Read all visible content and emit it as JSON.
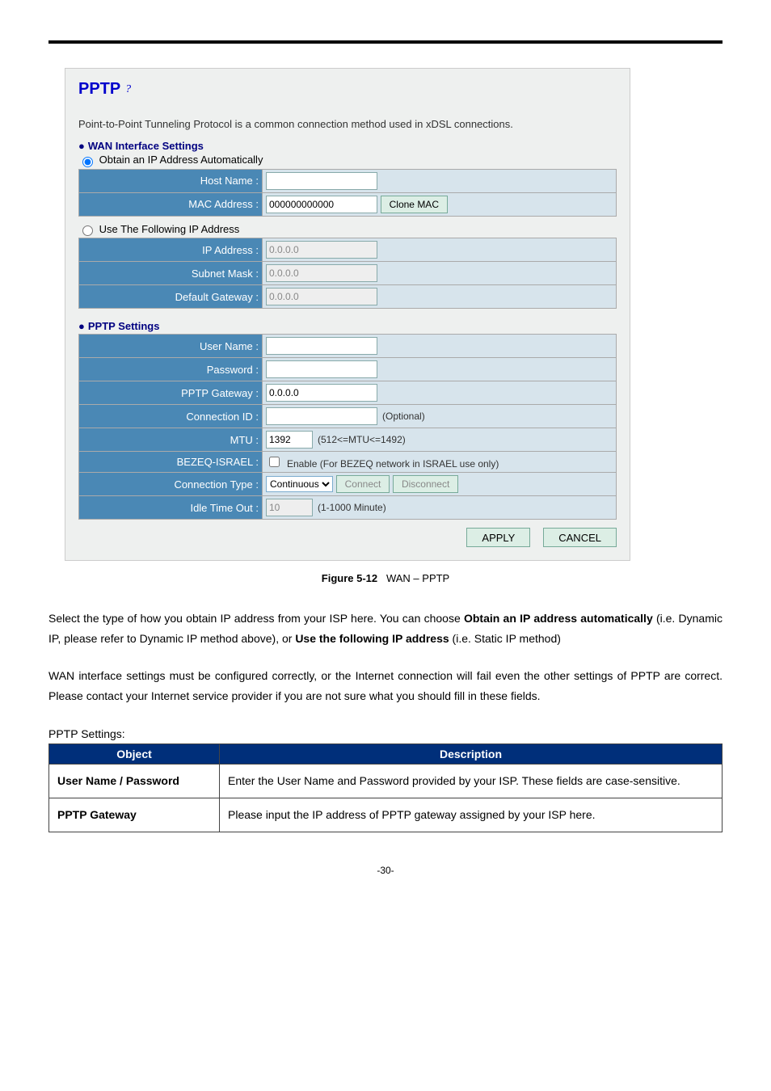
{
  "panel": {
    "title": "PPTP",
    "help_icon": "help-icon",
    "intro": "Point-to-Point Tunneling Protocol is a common connection method used in xDSL connections.",
    "wan_heading": "WAN Interface Settings",
    "obtain_label": "Obtain an IP Address Automatically",
    "use_following_label": "Use The Following IP Address",
    "labels": {
      "host_name": "Host Name :",
      "mac_address": "MAC Address :",
      "ip_address": "IP Address :",
      "subnet_mask": "Subnet Mask :",
      "default_gateway": "Default Gateway :"
    },
    "values": {
      "mac_address": "000000000000",
      "ip_address": "0.0.0.0",
      "subnet_mask": "0.0.0.0",
      "default_gateway": "0.0.0.0"
    },
    "clone_mac": "Clone MAC",
    "pptp_heading": "PPTP Settings",
    "plabels": {
      "user_name": "User Name :",
      "password": "Password :",
      "pptp_gateway": "PPTP Gateway :",
      "connection_id": "Connection ID :",
      "mtu": "MTU :",
      "bezeq": "BEZEQ-ISRAEL :",
      "conn_type": "Connection Type :",
      "idle": "Idle Time Out :"
    },
    "pvalues": {
      "pptp_gateway": "0.0.0.0",
      "conn_id_hint": "(Optional)",
      "mtu": "1392",
      "mtu_hint": "(512<=MTU<=1492)",
      "bezeq_label": "Enable (For BEZEQ network in ISRAEL use only)",
      "conn_type": "Continuous",
      "connect": "Connect",
      "disconnect": "Disconnect",
      "idle": "10",
      "idle_hint": "(1-1000 Minute)"
    },
    "apply": "APPLY",
    "cancel": "CANCEL"
  },
  "figure": {
    "label": "Figure 5-12",
    "caption": "WAN – PPTP"
  },
  "para1_a": "Select the type of how you obtain IP address from your ISP here. You can choose ",
  "para1_b": "Obtain an IP address automatically",
  "para1_c": " (i.e. Dynamic IP, please refer to Dynamic IP method above), or ",
  "para1_d": "Use the following IP address",
  "para1_e": " (i.e. Static IP method)",
  "para2": "WAN interface settings must be configured correctly, or the Internet connection will fail even the other settings of PPTP are correct. Please contact your Internet service provider if you are not sure what you should fill in these fields.",
  "table_heading": "PPTP Settings:",
  "table": {
    "h_object": "Object",
    "h_desc": "Description",
    "rows": [
      {
        "obj": "User Name / Password",
        "desc": "Enter the User Name and Password provided by your ISP. These fields are case-sensitive."
      },
      {
        "obj": "PPTP Gateway",
        "desc": "Please input the IP address of PPTP gateway assigned by your ISP here."
      }
    ]
  },
  "page_num": "-30-"
}
